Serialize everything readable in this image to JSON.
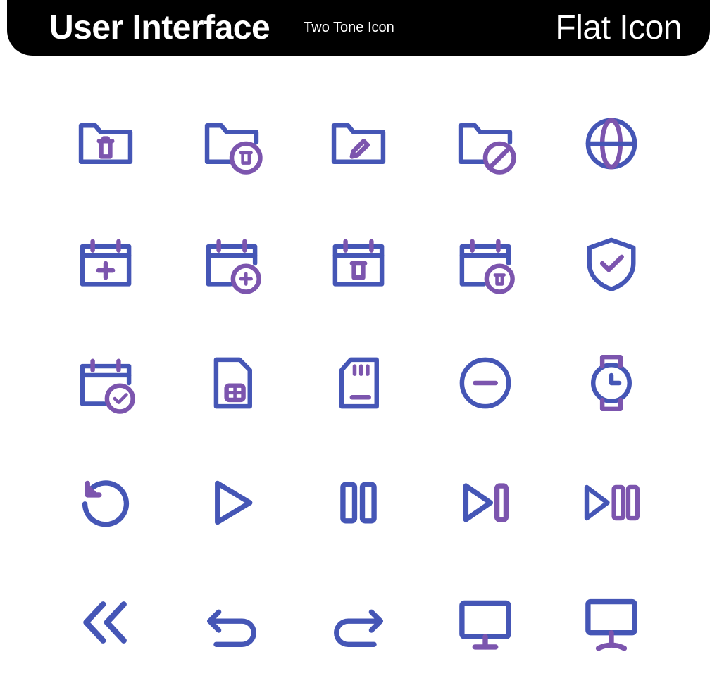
{
  "header": {
    "title_main": "User Interface",
    "title_sub": "Two Tone Icon",
    "title_right": "Flat Icon"
  },
  "colors": {
    "primary": "#4556B6",
    "accent": "#7C55AE"
  },
  "icons": [
    "folder-trash-icon",
    "folder-trash-badge-icon",
    "folder-edit-icon",
    "folder-blocked-icon",
    "globe-icon",
    "calendar-add-icon",
    "calendar-add-badge-icon",
    "calendar-trash-icon",
    "calendar-trash-badge-icon",
    "shield-check-icon",
    "calendar-check-badge-icon",
    "sim-card-icon",
    "sd-card-icon",
    "minus-circle-icon",
    "watch-icon",
    "reload-ccw-icon",
    "play-icon",
    "pause-icon",
    "skip-next-icon",
    "play-pause-icon",
    "rewind-double-icon",
    "undo-icon",
    "redo-icon",
    "monitor-icon",
    "monitor-stand-icon"
  ]
}
